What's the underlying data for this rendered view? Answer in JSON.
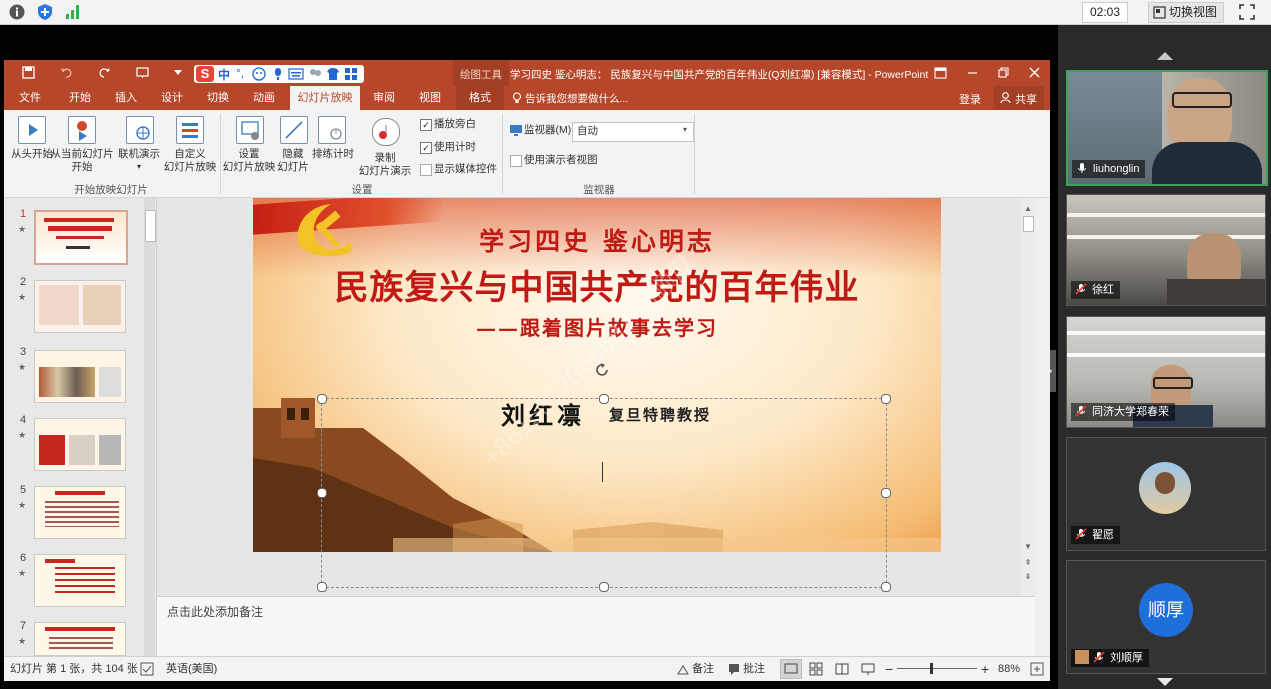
{
  "meeting": {
    "timer": "02:03",
    "switch_view_label": "切换视图"
  },
  "ppt": {
    "title_context": "绘图工具",
    "title": "学习四史  鉴心明志： 民族复兴与中国共产党的百年伟业(Q刘红凛)  [兼容模式] - PowerPoint",
    "tabs": [
      "文件",
      "开始",
      "插入",
      "设计",
      "切换",
      "动画",
      "幻灯片放映",
      "审阅",
      "视图",
      "格式"
    ],
    "active_tab": "幻灯片放映",
    "tell_me": "告诉我您想要做什么...",
    "login": "登录",
    "share": "共享",
    "ribbon": {
      "from_start": "从头开始",
      "from_current_1": "从当前幻灯片",
      "from_current_2": "开始",
      "online_1": "联机演示",
      "custom_1": "自定义",
      "custom_2": "幻灯片放映",
      "group_start": "开始放映幻灯片",
      "setup_1": "设置",
      "setup_2": "幻灯片放映",
      "hide_1": "隐藏",
      "hide_2": "幻灯片",
      "rehearse": "排练计时",
      "record_1": "录制",
      "record_2": "幻灯片演示",
      "chk_narration": "播放旁白",
      "chk_timing": "使用计时",
      "chk_media": "显示媒体控件",
      "group_setup": "设置",
      "monitor_label": "监视器(M):",
      "monitor_value": "自动",
      "presenter_view": "使用演示者视图",
      "group_monitor": "监视器"
    },
    "thumbs": [
      "1",
      "2",
      "3",
      "4",
      "5",
      "6",
      "7"
    ],
    "slide": {
      "line1": "学习四史  鉴心明志",
      "line2": "民族复兴与中国共产党的百年伟业",
      "line3": "——跟着图片故事去学习",
      "author": "刘红凛",
      "author_title": "复旦特聘教授",
      "watermark": "+8615317066587 刘顺厚"
    },
    "notes_placeholder": "点击此处添加备注",
    "status": {
      "slide_info": "幻灯片 第 1 张，共 104 张",
      "language": "英语(美国)",
      "notes_btn": "备注",
      "comments_btn": "批注",
      "zoom": "88%"
    }
  },
  "participants": [
    {
      "name": "liuhonglin"
    },
    {
      "name": "徐红"
    },
    {
      "name": "同济大学郑春荣"
    },
    {
      "name": "翟愿"
    },
    {
      "name": "刘顺厚",
      "avatar_text": "顺厚"
    }
  ],
  "colors": {
    "ppt_accent": "#b7472a",
    "title_red": "#c01a14",
    "avatar_blue": "#1e6fd9"
  }
}
